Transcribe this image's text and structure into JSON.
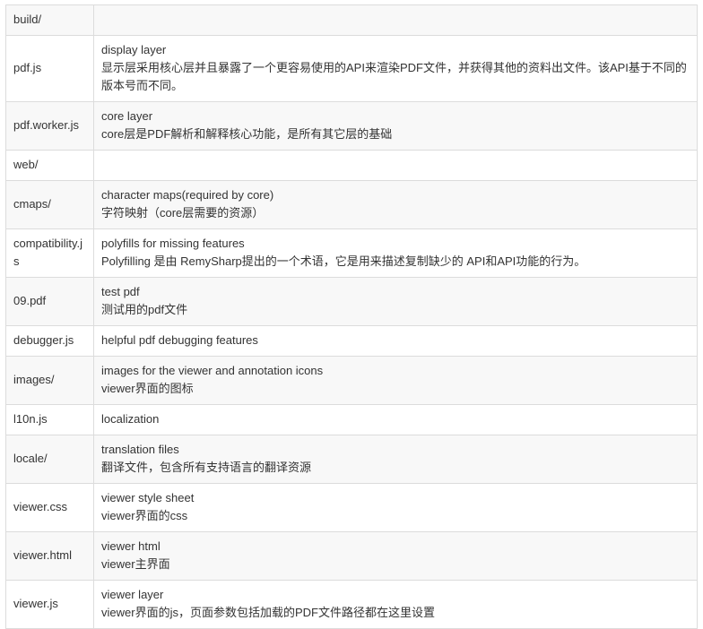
{
  "rows": [
    {
      "file": "build/",
      "desc": []
    },
    {
      "file": "pdf.js",
      "desc": [
        "display layer",
        "显示层采用核心层并且暴露了一个更容易使用的API来渲染PDF文件，并获得其他的资料出文件。该API基于不同的版本号而不同。"
      ]
    },
    {
      "file": "pdf.worker.js",
      "desc": [
        "core layer",
        "core层是PDF解析和解释核心功能，是所有其它层的基础"
      ]
    },
    {
      "file": "web/",
      "desc": []
    },
    {
      "file": "cmaps/",
      "desc": [
        "character maps(required by core)",
        "字符映射（core层需要的资源）"
      ]
    },
    {
      "file": "compatibility.js",
      "desc": [
        "polyfills for missing features",
        "Polyfilling 是由 RemySharp提出的一个术语，它是用来描述复制缺少的 API和API功能的行为。"
      ]
    },
    {
      "file": "09.pdf",
      "desc": [
        "test pdf",
        "测试用的pdf文件"
      ]
    },
    {
      "file": "debugger.js",
      "desc": [
        "helpful pdf debugging features"
      ]
    },
    {
      "file": "images/",
      "desc": [
        "images for the viewer and annotation icons",
        "viewer界面的图标"
      ]
    },
    {
      "file": "l10n.js",
      "desc": [
        "localization"
      ]
    },
    {
      "file": "locale/",
      "desc": [
        "translation files",
        "翻译文件，包含所有支持语言的翻译资源"
      ]
    },
    {
      "file": "viewer.css",
      "desc": [
        "viewer style sheet",
        "viewer界面的css"
      ]
    },
    {
      "file": "viewer.html",
      "desc": [
        "viewer html",
        "viewer主界面"
      ]
    },
    {
      "file": "viewer.js",
      "desc": [
        "viewer layer",
        "viewer界面的js，页面参数包括加载的PDF文件路径都在这里设置"
      ]
    }
  ]
}
